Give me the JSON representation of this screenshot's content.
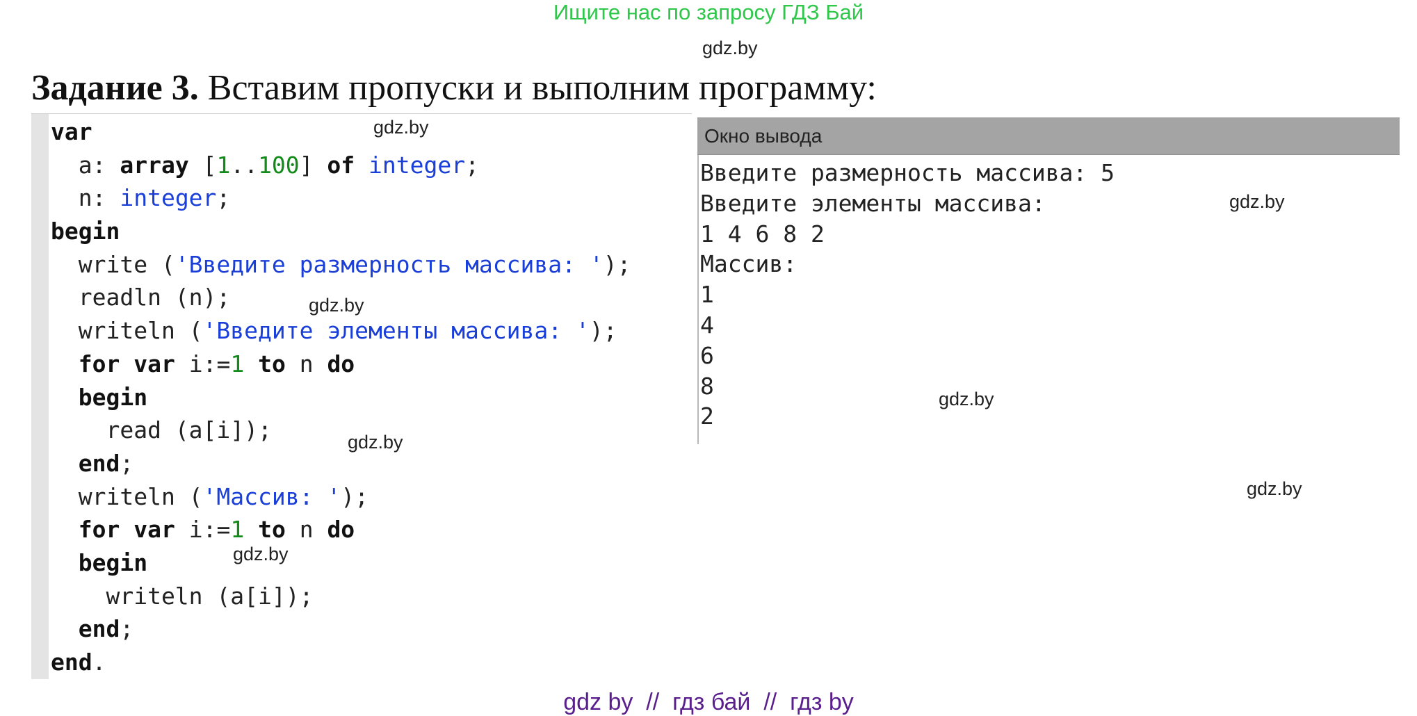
{
  "banner": "Ищите нас по запросу ГДЗ Бай",
  "watermark": "gdz.by",
  "heading": {
    "bold": "Задание 3.",
    "text": " Вставим пропуски и выполним программу:"
  },
  "code_lines": [
    [
      {
        "t": "var",
        "c": "kw"
      }
    ],
    [
      {
        "t": "  a: ",
        "c": ""
      },
      {
        "t": "array",
        "c": "kw"
      },
      {
        "t": " [",
        "c": ""
      },
      {
        "t": "1",
        "c": "nm"
      },
      {
        "t": "..",
        "c": ""
      },
      {
        "t": "100",
        "c": "nm"
      },
      {
        "t": "] ",
        "c": ""
      },
      {
        "t": "of",
        "c": "kw"
      },
      {
        "t": " ",
        "c": ""
      },
      {
        "t": "integer",
        "c": "ty"
      },
      {
        "t": ";",
        "c": ""
      }
    ],
    [
      {
        "t": "  n: ",
        "c": ""
      },
      {
        "t": "integer",
        "c": "ty"
      },
      {
        "t": ";",
        "c": ""
      }
    ],
    [
      {
        "t": "begin",
        "c": "kw"
      }
    ],
    [
      {
        "t": "  write (",
        "c": ""
      },
      {
        "t": "'Введите размерность массива: '",
        "c": "st"
      },
      {
        "t": ");",
        "c": ""
      }
    ],
    [
      {
        "t": "  readln (n);",
        "c": ""
      }
    ],
    [
      {
        "t": "  writeln (",
        "c": ""
      },
      {
        "t": "'Введите элементы массива: '",
        "c": "st"
      },
      {
        "t": ");",
        "c": ""
      }
    ],
    [
      {
        "t": "  ",
        "c": ""
      },
      {
        "t": "for",
        "c": "kw"
      },
      {
        "t": " ",
        "c": ""
      },
      {
        "t": "var",
        "c": "kw"
      },
      {
        "t": " i:=",
        "c": ""
      },
      {
        "t": "1",
        "c": "nm"
      },
      {
        "t": " ",
        "c": ""
      },
      {
        "t": "to",
        "c": "kw"
      },
      {
        "t": " n ",
        "c": ""
      },
      {
        "t": "do",
        "c": "kw"
      }
    ],
    [
      {
        "t": "  ",
        "c": ""
      },
      {
        "t": "begin",
        "c": "kw"
      }
    ],
    [
      {
        "t": "    read (a[i]);",
        "c": ""
      }
    ],
    [
      {
        "t": "  ",
        "c": ""
      },
      {
        "t": "end",
        "c": "kw"
      },
      {
        "t": ";",
        "c": ""
      }
    ],
    [
      {
        "t": "  writeln (",
        "c": ""
      },
      {
        "t": "'Массив: '",
        "c": "st"
      },
      {
        "t": ");",
        "c": ""
      }
    ],
    [
      {
        "t": "  ",
        "c": ""
      },
      {
        "t": "for",
        "c": "kw"
      },
      {
        "t": " ",
        "c": ""
      },
      {
        "t": "var",
        "c": "kw"
      },
      {
        "t": " i:=",
        "c": ""
      },
      {
        "t": "1",
        "c": "nm"
      },
      {
        "t": " ",
        "c": ""
      },
      {
        "t": "to",
        "c": "kw"
      },
      {
        "t": " n ",
        "c": ""
      },
      {
        "t": "do",
        "c": "kw"
      }
    ],
    [
      {
        "t": "  ",
        "c": ""
      },
      {
        "t": "begin",
        "c": "kw"
      }
    ],
    [
      {
        "t": "    writeln (a[i]);",
        "c": ""
      }
    ],
    [
      {
        "t": "  ",
        "c": ""
      },
      {
        "t": "end",
        "c": "kw"
      },
      {
        "t": ";",
        "c": ""
      }
    ],
    [
      {
        "t": "end",
        "c": "kw"
      },
      {
        "t": ".",
        "c": ""
      }
    ]
  ],
  "output_window": {
    "title": "Окно вывода",
    "lines": [
      "Введите размерность массива: 5",
      "Введите элементы массива:",
      "1 4 6 8 2",
      "Массив:",
      "1",
      "4",
      "6",
      "8",
      "2"
    ]
  },
  "footer": "gdz by  //  гдз бай  //  гдз by"
}
